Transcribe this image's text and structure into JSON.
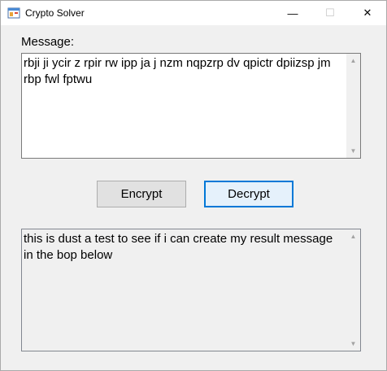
{
  "window": {
    "title": "Crypto Solver",
    "minimize_glyph": "—",
    "maximize_glyph": "☐",
    "close_glyph": "✕"
  },
  "message": {
    "label": "Message:",
    "value": "rbji ji ycir z rpir rw ipp ja j nzm nqpzrp dv qpictr dpiizsp jm rbp fwl fptwu"
  },
  "buttons": {
    "encrypt_label": "Encrypt",
    "decrypt_label": "Decrypt"
  },
  "result": {
    "value": "this is dust a test to see if i can create my result message in the bop below"
  },
  "scroll": {
    "up_glyph": "▲",
    "down_glyph": "▼"
  },
  "icons": [
    "app-icon",
    "minimize-icon",
    "maximize-icon",
    "close-icon",
    "scroll-up-icon",
    "scroll-down-icon"
  ]
}
